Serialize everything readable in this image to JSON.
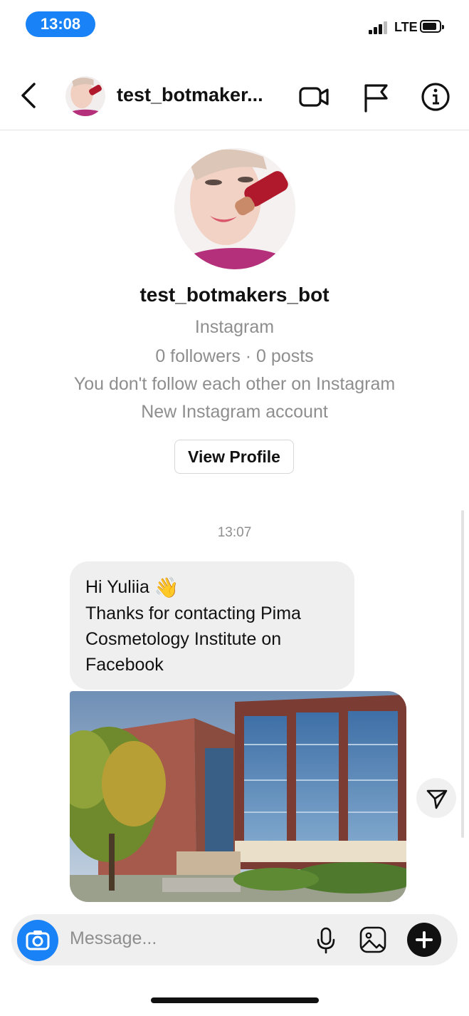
{
  "status_bar": {
    "time": "13:08",
    "network": "LTE"
  },
  "header": {
    "username": "test_botmaker..."
  },
  "profile": {
    "username": "test_botmakers_bot",
    "platform": "Instagram",
    "stats": "0 followers · 0 posts",
    "relationship": "You don't follow each other on Instagram",
    "account_note": "New Instagram account",
    "view_profile_label": "View Profile"
  },
  "conversation": {
    "timestamp": "13:07",
    "message_lines": [
      "Hi Yuliia",
      "Thanks for contacting Pima",
      "Cosmetology Institute on",
      "Facebook"
    ],
    "wave_emoji": "👋"
  },
  "composer": {
    "placeholder": "Message..."
  },
  "colors": {
    "accent": "#1a82f7",
    "bubble": "#efefef",
    "muted_text": "#8e8e8e"
  },
  "icons": [
    "back-chevron-icon",
    "video-call-icon",
    "flag-icon",
    "info-icon",
    "send-icon",
    "camera-icon",
    "microphone-icon",
    "gallery-icon",
    "plus-icon"
  ]
}
